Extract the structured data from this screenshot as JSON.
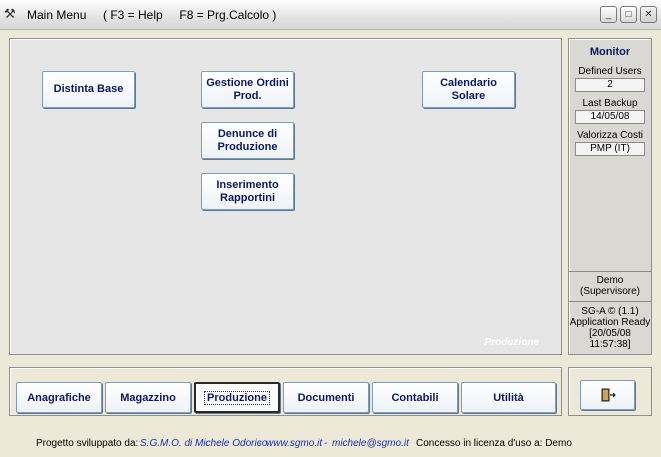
{
  "window": {
    "title": "Main Menu",
    "hint": "( F3 = Help     F8 = Prg.Calcolo )",
    "controls": {
      "minimize": "_",
      "maximize": "□",
      "close": "✕"
    }
  },
  "main": {
    "buttons": {
      "distinta": "Distinta Base",
      "gestione": "Gestione Ordini Prod.",
      "denunce": "Denunce di Produzione",
      "inserimento": "Inserimento Rapportini",
      "calendario": "Calendario Solare"
    },
    "watermark": "Produzione"
  },
  "monitor": {
    "title": "Monitor",
    "defined_users_label": "Defined Users",
    "defined_users_value": "2",
    "last_backup_label": "Last Backup",
    "last_backup_value": "14/05/08",
    "valorizza_label": "Valorizza Costi",
    "valorizza_value": "PMP (IT)",
    "user_name": "Demo",
    "user_role": "(Supervisore)",
    "version": "SG-A © (1.1)",
    "status": "Application Ready",
    "date": "[20/05/08",
    "time": "11:57:38]"
  },
  "tabs": {
    "anagrafiche": "Anagrafiche",
    "magazzino": "Magazzino",
    "produzione": "Produzione",
    "documenti": "Documenti",
    "contabili": "Contabili",
    "utilita": "Utilità"
  },
  "footer": {
    "developed_by": "Progetto sviluppato da:",
    "company": "S.G.M.O. di Michele Odorico",
    "sep1": "-",
    "website": "www.sgmo.it",
    "sep2": "-",
    "email": "michele@sgmo.it",
    "license": "Concesso in licenza d'uso a: Demo"
  },
  "icons": {
    "app": "tools-icon",
    "exit": "exit-door-icon"
  },
  "colors": {
    "button_text": "#0b1a60",
    "link": "#1a2fb5",
    "panel": "#e6e6e6"
  }
}
